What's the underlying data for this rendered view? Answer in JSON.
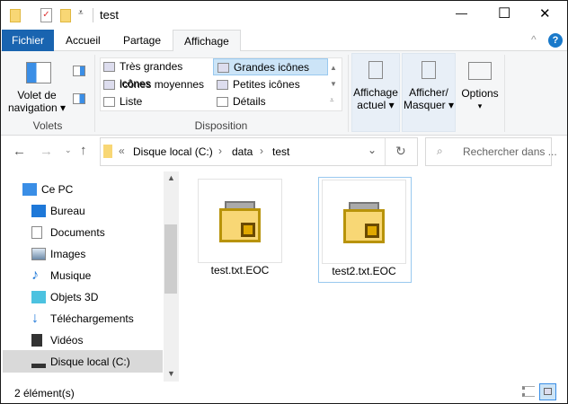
{
  "window": {
    "title": "test",
    "minimize": "—",
    "maximize": "☐",
    "close": "✕"
  },
  "tabs": [
    {
      "label": "Fichier"
    },
    {
      "label": "Accueil"
    },
    {
      "label": "Partage"
    },
    {
      "label": "Affichage"
    }
  ],
  "ribbon": {
    "volets": {
      "nav_pane": "Volet de",
      "nav_pane2": "navigation ▾",
      "group": "Volets"
    },
    "layout": {
      "items": [
        "Très grandes icônes",
        "Grandes icônes",
        "Icônes moyennes",
        "Petites icônes",
        "Liste",
        "Détails"
      ],
      "group": "Disposition",
      "selected": "Grandes icônes"
    },
    "current_view": {
      "l1": "Affichage",
      "l2": "actuel ▾"
    },
    "show_hide": {
      "l1": "Afficher/",
      "l2": "Masquer ▾"
    },
    "options": {
      "l1": "Options",
      "l2": "▾"
    }
  },
  "address": {
    "prefix": "«",
    "crumbs": [
      "Disque local (C:)",
      "data",
      "test"
    ],
    "sep": "›"
  },
  "search": {
    "placeholder": "Rechercher dans ..."
  },
  "nav": {
    "root": "Ce PC",
    "items": [
      "Bureau",
      "Documents",
      "Images",
      "Musique",
      "Objets 3D",
      "Téléchargements",
      "Vidéos",
      "Disque local (C:)"
    ],
    "selected": "Disque local (C:)"
  },
  "files": [
    {
      "name": "test.txt.EOC"
    },
    {
      "name": "test2.txt.EOC"
    }
  ],
  "status": {
    "count": "2 élément(s)"
  },
  "colors": {
    "accent": "#1979ca",
    "fichier": "#1964b0",
    "folder": "#f8d775",
    "folder_dark": "#b8930a"
  }
}
